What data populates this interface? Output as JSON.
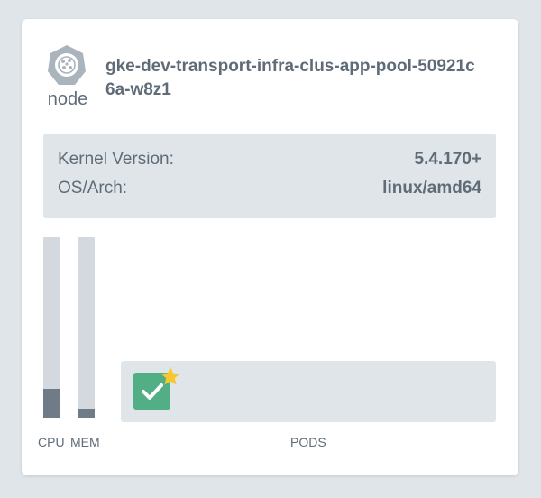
{
  "node": {
    "type_label": "node",
    "name": "gke-dev-transport-infra-clus-app-pool-50921c6a-w8z1",
    "icon": "kubernetes-node-icon"
  },
  "info": {
    "rows": [
      {
        "key": "Kernel Version:",
        "value": "5.4.170+"
      },
      {
        "key": "OS/Arch:",
        "value": "linux/amd64"
      }
    ]
  },
  "usage": {
    "cpu_label": "CPU",
    "mem_label": "MEM",
    "cpu_fraction": 0.16,
    "mem_fraction": 0.05
  },
  "pods": {
    "label": "PODS",
    "items": [
      {
        "status": "ready",
        "icon": "check-icon",
        "badge": "star-icon"
      }
    ]
  },
  "colors": {
    "background": "#dfe5e9",
    "card": "#ffffff",
    "text": "#5f6c78",
    "bar_track": "#d3d9de",
    "bar_fill": "#6f7c88",
    "pod_ready": "#51ae85",
    "star": "#f8c72f"
  }
}
